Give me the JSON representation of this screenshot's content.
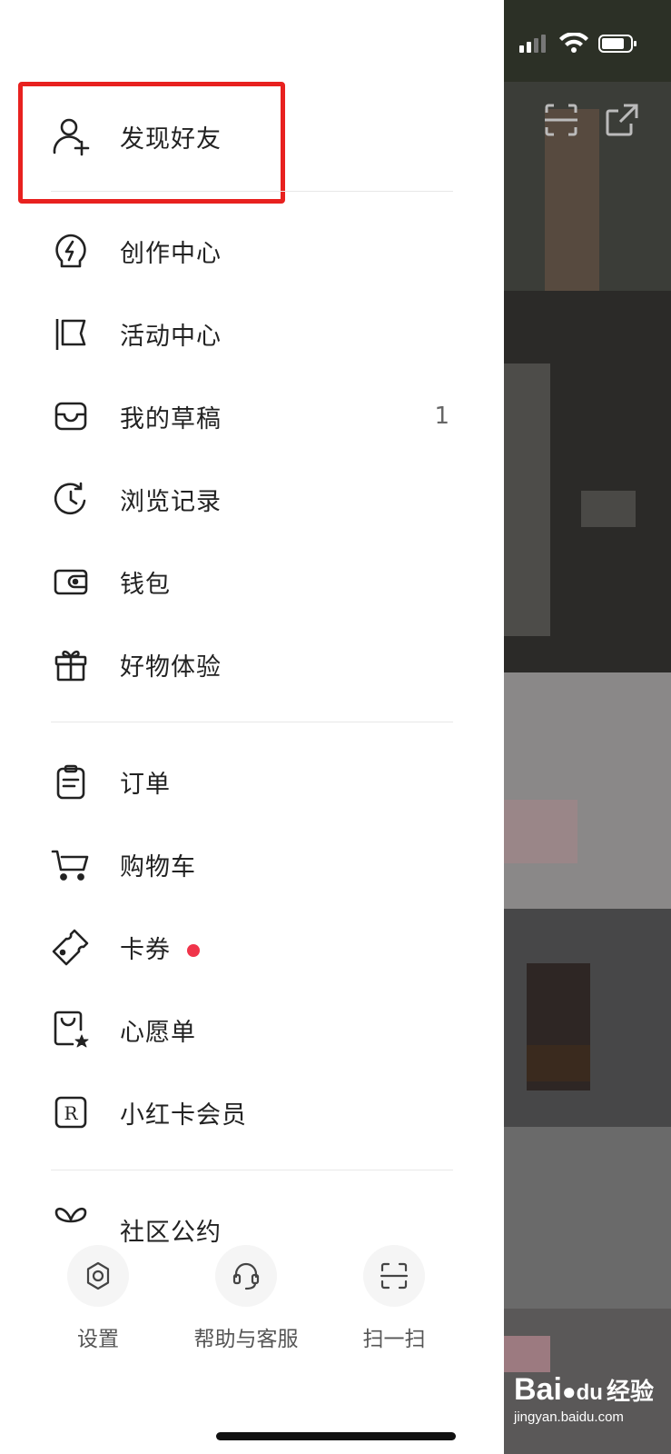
{
  "menu": {
    "find_friends": "发现好友",
    "creator_center": "创作中心",
    "activity_center": "活动中心",
    "drafts": "我的草稿",
    "drafts_count": "1",
    "history": "浏览记录",
    "wallet": "钱包",
    "trial": "好物体验",
    "orders": "订单",
    "cart": "购物车",
    "coupons": "卡券",
    "wishlist": "心愿单",
    "redcard": "小红卡会员",
    "community": "社区公约"
  },
  "bottom": {
    "settings": "设置",
    "help": "帮助与客服",
    "scan": "扫一扫"
  },
  "watermark": {
    "brand": "Bai",
    "brand2": "du",
    "suffix": "经验",
    "url": "jingyan.baidu.com"
  },
  "colors": {
    "highlight": "#e8211f",
    "dot": "#f0344a"
  }
}
